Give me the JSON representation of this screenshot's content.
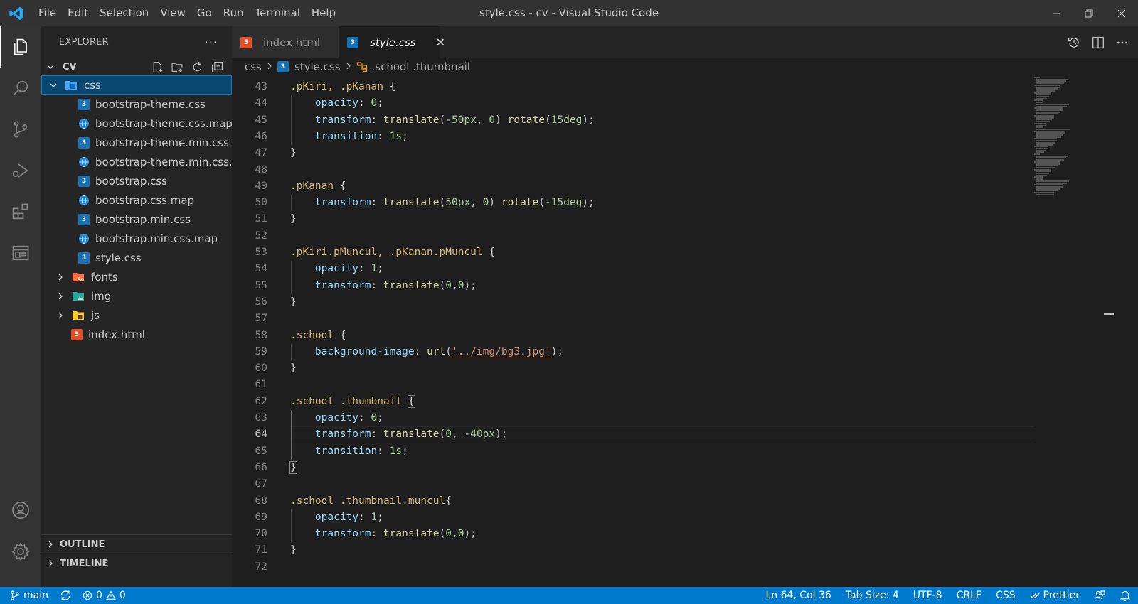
{
  "window": {
    "title": "style.css - cv - Visual Studio Code",
    "menu": [
      "File",
      "Edit",
      "Selection",
      "View",
      "Go",
      "Run",
      "Terminal",
      "Help"
    ]
  },
  "activity_bar": {
    "items": [
      "explorer-icon",
      "search-icon",
      "source-control-icon",
      "run-debug-icon",
      "extensions-icon",
      "remote-explorer-icon"
    ],
    "bottom": [
      "account-icon",
      "manage-gear-icon"
    ],
    "active": "explorer-icon"
  },
  "sidebar": {
    "title": "EXPLORER",
    "more": "···",
    "folder": "CV",
    "tree": [
      {
        "label": "css",
        "type": "folder-open",
        "depth": 1
      },
      {
        "label": "bootstrap-theme.css",
        "type": "css",
        "depth": 2
      },
      {
        "label": "bootstrap-theme.css.map",
        "type": "map",
        "depth": 2
      },
      {
        "label": "bootstrap-theme.min.css",
        "type": "css",
        "depth": 2
      },
      {
        "label": "bootstrap-theme.min.css...",
        "type": "map",
        "depth": 2
      },
      {
        "label": "bootstrap.css",
        "type": "css",
        "depth": 2
      },
      {
        "label": "bootstrap.css.map",
        "type": "map",
        "depth": 2
      },
      {
        "label": "bootstrap.min.css",
        "type": "css",
        "depth": 2
      },
      {
        "label": "bootstrap.min.css.map",
        "type": "map",
        "depth": 2
      },
      {
        "label": "style.css",
        "type": "css",
        "depth": 2
      },
      {
        "label": "fonts",
        "type": "folder",
        "depth": 1
      },
      {
        "label": "img",
        "type": "folder",
        "depth": 1
      },
      {
        "label": "js",
        "type": "folder",
        "depth": 1
      },
      {
        "label": "index.html",
        "type": "html",
        "depth": 1
      }
    ],
    "sections": [
      "OUTLINE",
      "TIMELINE"
    ]
  },
  "tabs": [
    {
      "label": "index.html",
      "icon": "html5-icon",
      "active": false
    },
    {
      "label": "style.css",
      "icon": "css3-icon",
      "active": true,
      "close": "✕"
    }
  ],
  "breadcrumb": {
    "folder": "css",
    "file": "style.css",
    "symbol": ".school .thumbnail"
  },
  "editor": {
    "current_line": 64,
    "lines": [
      {
        "n": "43",
        "code": ".pKiri, .pKanan {"
      },
      {
        "n": "44",
        "code": "    opacity: 0;"
      },
      {
        "n": "45",
        "code": "    transform: translate(-50px, 0) rotate(15deg);"
      },
      {
        "n": "46",
        "code": "    transition: 1s;"
      },
      {
        "n": "47",
        "code": "}"
      },
      {
        "n": "48",
        "code": ""
      },
      {
        "n": "49",
        "code": ".pKanan {"
      },
      {
        "n": "50",
        "code": "    transform: translate(50px, 0) rotate(-15deg);"
      },
      {
        "n": "51",
        "code": "}"
      },
      {
        "n": "52",
        "code": ""
      },
      {
        "n": "53",
        "code": ".pKiri.pMuncul, .pKanan.pMuncul {"
      },
      {
        "n": "54",
        "code": "    opacity: 1;"
      },
      {
        "n": "55",
        "code": "    transform: translate(0,0);"
      },
      {
        "n": "56",
        "code": "}"
      },
      {
        "n": "57",
        "code": ""
      },
      {
        "n": "58",
        "code": ".school {"
      },
      {
        "n": "59",
        "code": "    background-image: url('../img/bg3.jpg');"
      },
      {
        "n": "60",
        "code": "}"
      },
      {
        "n": "61",
        "code": ""
      },
      {
        "n": "62",
        "code": ".school .thumbnail {"
      },
      {
        "n": "63",
        "code": "    opacity: 0;"
      },
      {
        "n": "64",
        "code": "    transform: translate(0, -40px);"
      },
      {
        "n": "65",
        "code": "    transition: 1s;"
      },
      {
        "n": "66",
        "code": "}"
      },
      {
        "n": "67",
        "code": ""
      },
      {
        "n": "68",
        "code": ".school .thumbnail.muncul{"
      },
      {
        "n": "69",
        "code": "    opacity: 1;"
      },
      {
        "n": "70",
        "code": "    transform: translate(0,0);"
      },
      {
        "n": "71",
        "code": "}"
      },
      {
        "n": "72",
        "code": ""
      }
    ]
  },
  "status_bar": {
    "branch": "main",
    "errors": "0",
    "warnings": "0",
    "position": "Ln 64, Col 36",
    "tab_size": "Tab Size: 4",
    "encoding": "UTF-8",
    "eol": "CRLF",
    "language": "CSS",
    "formatter": "Prettier"
  },
  "colors": {
    "status_bar": "#007acc",
    "selection": "#094771",
    "activity_bar": "#333333",
    "sidebar": "#252526",
    "editor": "#1e1e1e"
  }
}
